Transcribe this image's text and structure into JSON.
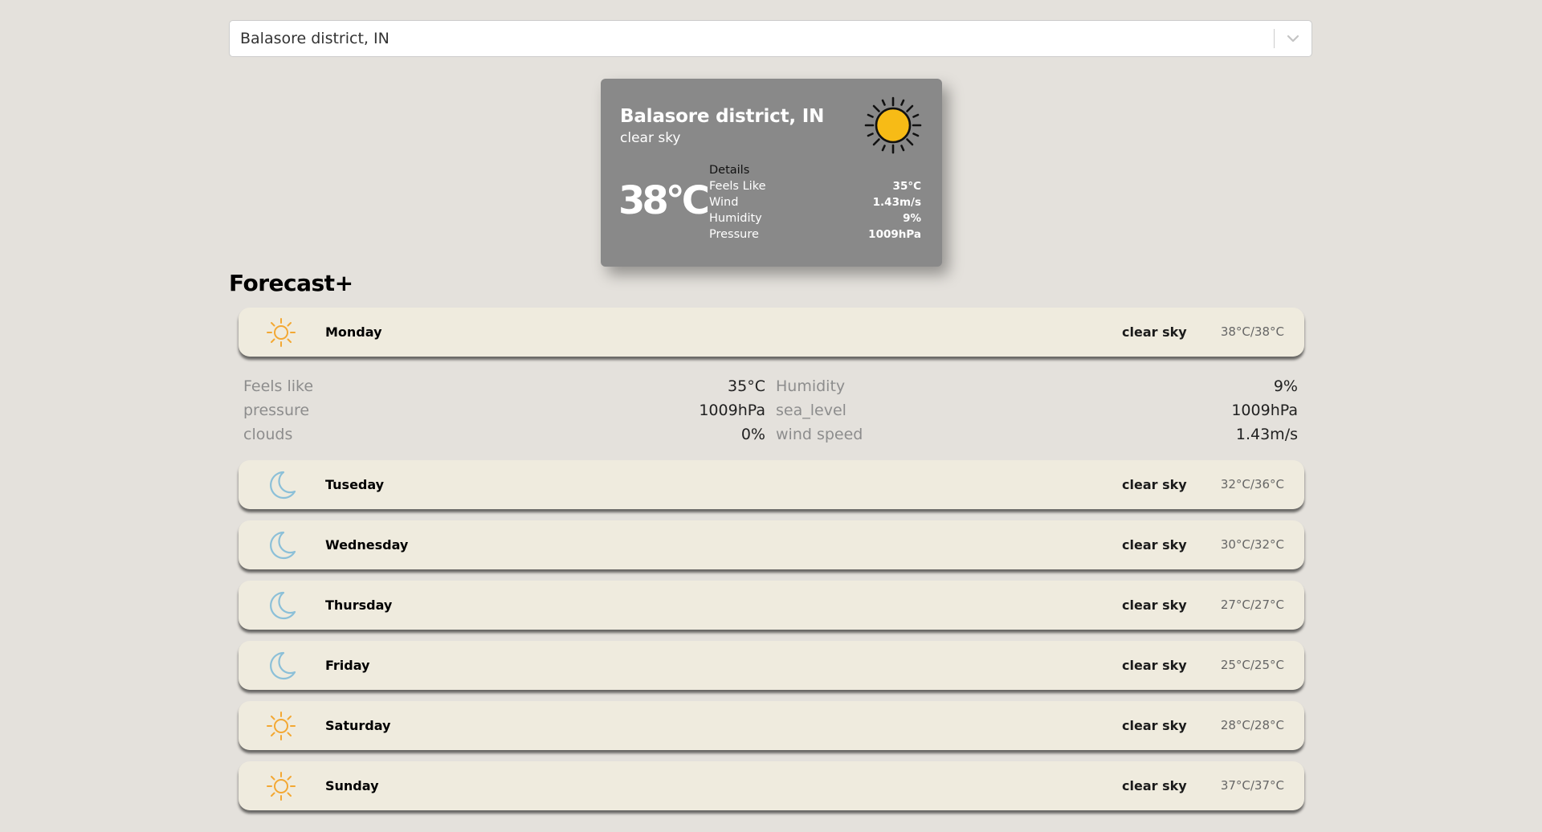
{
  "search": {
    "value": "Balasore district, IN"
  },
  "current": {
    "city": "Balasore district, IN",
    "description": "clear sky",
    "temperature": "38°C",
    "icon": "sun-icon",
    "details": {
      "title": "Details",
      "rows": [
        {
          "label": "Feels Like",
          "value": "35°C"
        },
        {
          "label": "Wind",
          "value": "1.43m/s"
        },
        {
          "label": "Humidity",
          "value": "9%"
        },
        {
          "label": "Pressure",
          "value": "1009hPa"
        }
      ]
    }
  },
  "forecast": {
    "title": "Forecast+",
    "days": [
      {
        "name": "Monday",
        "icon": "sun-icon",
        "description": "clear sky",
        "temps": "38°C/38°C"
      },
      {
        "name": "Tuseday",
        "icon": "moon-icon",
        "description": "clear sky",
        "temps": "32°C/36°C"
      },
      {
        "name": "Wednesday",
        "icon": "moon-icon",
        "description": "clear sky",
        "temps": "30°C/32°C"
      },
      {
        "name": "Thursday",
        "icon": "moon-icon",
        "description": "clear sky",
        "temps": "27°C/27°C"
      },
      {
        "name": "Friday",
        "icon": "moon-icon",
        "description": "clear sky",
        "temps": "25°C/25°C"
      },
      {
        "name": "Saturday",
        "icon": "sun-icon",
        "description": "clear sky",
        "temps": "28°C/28°C"
      },
      {
        "name": "Sunday",
        "icon": "sun-icon",
        "description": "clear sky",
        "temps": "37°C/37°C"
      }
    ],
    "expanded": {
      "left": [
        {
          "label": "Feels like",
          "value": "35°C"
        },
        {
          "label": "pressure",
          "value": "1009hPa"
        },
        {
          "label": "clouds",
          "value": "0%"
        }
      ],
      "right": [
        {
          "label": "Humidity",
          "value": "9%"
        },
        {
          "label": "sea_level",
          "value": "1009hPa"
        },
        {
          "label": "wind speed",
          "value": "1.43m/s"
        }
      ]
    }
  },
  "colors": {
    "background": "#e4e1dc",
    "card": "#898989",
    "row": "#efebde",
    "sun_big": "#f7bb16",
    "sun_small": "#f3a833",
    "moon": "#8cc0d8"
  }
}
